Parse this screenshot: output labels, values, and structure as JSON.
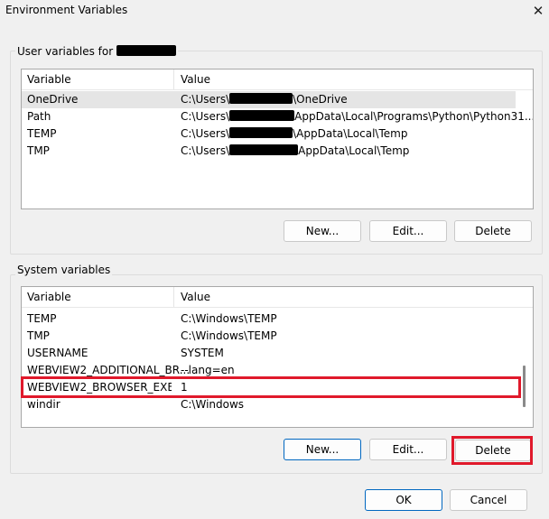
{
  "window": {
    "title": "Environment Variables",
    "close_glyph": "✕"
  },
  "user_group": {
    "legend": "User variables for",
    "columns": [
      "Variable",
      "Value"
    ],
    "rows": [
      {
        "variable": "OneDrive",
        "value_prefix": "C:\\Users\\",
        "value_suffix": "\\OneDrive"
      },
      {
        "variable": "Path",
        "value_prefix": "C:\\Users\\",
        "value_suffix": "AppData\\Local\\Programs\\Python\\Python31..."
      },
      {
        "variable": "TEMP",
        "value_prefix": "C:\\Users\\",
        "value_suffix": "\\AppData\\Local\\Temp"
      },
      {
        "variable": "TMP",
        "value_prefix": "C:\\Users\\",
        "value_suffix": "AppData\\Local\\Temp"
      }
    ],
    "buttons": {
      "new": "New...",
      "edit": "Edit...",
      "delete": "Delete"
    }
  },
  "system_group": {
    "legend": "System variables",
    "columns": [
      "Variable",
      "Value"
    ],
    "rows": [
      {
        "variable": "TEMP",
        "value": "C:\\Windows\\TEMP"
      },
      {
        "variable": "TMP",
        "value": "C:\\Windows\\TEMP"
      },
      {
        "variable": "USERNAME",
        "value": "SYSTEM"
      },
      {
        "variable": "WEBVIEW2_ADDITIONAL_BR...",
        "value": "--lang=en"
      },
      {
        "variable": "WEBVIEW2_BROWSER_EXEC...",
        "value": "1"
      },
      {
        "variable": "windir",
        "value": "C:\\Windows"
      }
    ],
    "buttons": {
      "new": "New...",
      "edit": "Edit...",
      "delete": "Delete"
    }
  },
  "footer": {
    "ok": "OK",
    "cancel": "Cancel"
  },
  "colors": {
    "highlight": "#e0192b",
    "accent": "#0067c0"
  }
}
